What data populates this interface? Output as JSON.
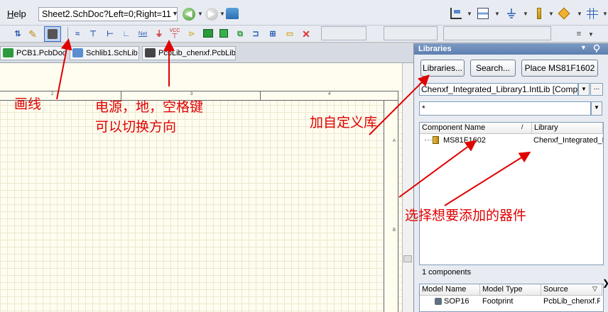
{
  "menu": {
    "help_prefix": "H",
    "help_rest": "elp"
  },
  "address": {
    "value": "Sheet2.SchDoc?Left=0;Right=11"
  },
  "doc_tabs": [
    {
      "label": "PCB1.PcbDoc"
    },
    {
      "label": "Schlib1.SchLib"
    },
    {
      "label": "PcbLib_chenxf.PcbLib"
    }
  ],
  "toolbar2": {
    "net_label": "Net",
    "vcc_label": "VCC"
  },
  "ruler": {
    "ticks": [
      "2",
      "3",
      "4"
    ],
    "side_marks": [
      "A",
      "B"
    ]
  },
  "annotations": {
    "wire": "画线",
    "power_line1": "电源，地，空格键",
    "power_line2": "可以切换方向",
    "custom_lib": "加自定义库",
    "select_component": "选择想要添加的器件"
  },
  "libraries_panel": {
    "title": "Libraries",
    "buttons": {
      "libraries": "Libraries...",
      "search": "Search...",
      "place": "Place MS81F1602"
    },
    "library_select": "Chenxf_Integrated_Library1.IntLib [Component",
    "more_label": "...",
    "filter_value": "*",
    "columns": {
      "name": "Component Name",
      "library": "Library"
    },
    "components": [
      {
        "name": "MS81F1602",
        "library": "Chenxf_Integrated_L"
      }
    ],
    "count": "1 components",
    "model_columns": {
      "name": "Model Name",
      "type": "Model Type",
      "source": "Source"
    },
    "models": [
      {
        "name": "SOP16",
        "type": "Footprint",
        "source": "PcbLib_chenxf.P"
      }
    ]
  },
  "colors": {
    "annotation": "#e00000",
    "panel_header": "#5d7fb0",
    "sheet_bg": "#fffdf0",
    "grid": "#ece7cf"
  }
}
